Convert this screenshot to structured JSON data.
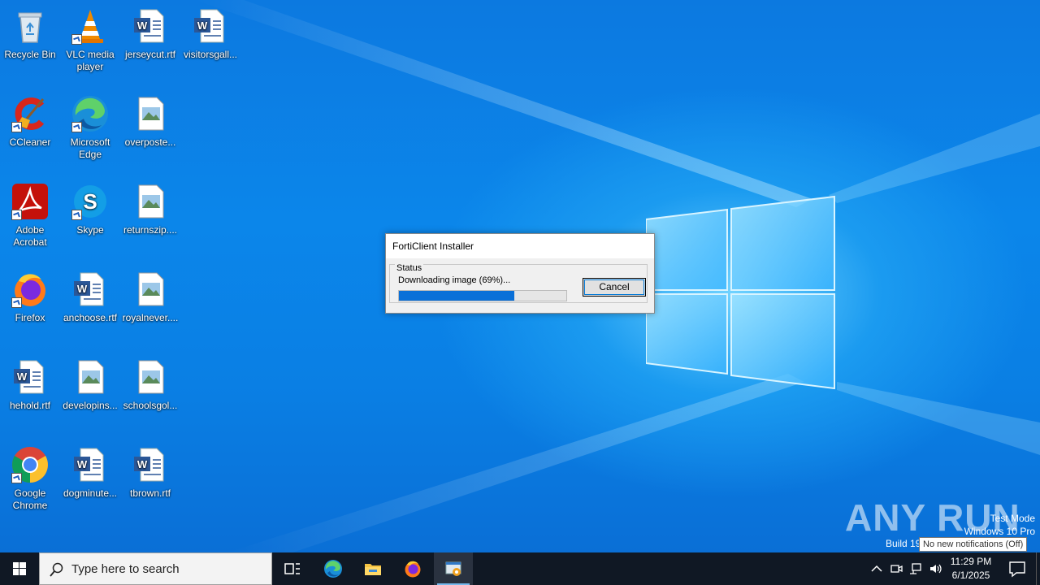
{
  "desktop_icons": [
    {
      "label": "Recycle Bin",
      "icon": "recycle-bin-icon"
    },
    {
      "label": "VLC media player",
      "icon": "vlc-icon"
    },
    {
      "label": "jerseycut.rtf",
      "icon": "word-doc-icon"
    },
    {
      "label": "visitorsgall...",
      "icon": "word-doc-icon"
    },
    {
      "label": "CCleaner",
      "icon": "ccleaner-icon"
    },
    {
      "label": "Microsoft Edge",
      "icon": "edge-icon"
    },
    {
      "label": "overposte...",
      "icon": "image-file-icon"
    },
    {
      "label": "Adobe Acrobat",
      "icon": "acrobat-icon"
    },
    {
      "label": "Skype",
      "icon": "skype-icon"
    },
    {
      "label": "returnszip....",
      "icon": "image-file-icon"
    },
    {
      "label": "Firefox",
      "icon": "firefox-icon"
    },
    {
      "label": "anchoose.rtf",
      "icon": "word-doc-icon"
    },
    {
      "label": "royalnever....",
      "icon": "image-file-icon"
    },
    {
      "label": "hehold.rtf",
      "icon": "word-doc-icon"
    },
    {
      "label": "developins...",
      "icon": "image-file-icon"
    },
    {
      "label": "schoolsgol...",
      "icon": "image-file-icon"
    },
    {
      "label": "Google Chrome",
      "icon": "chrome-icon"
    },
    {
      "label": "dogminute...",
      "icon": "word-doc-icon"
    },
    {
      "label": "tbrown.rtf",
      "icon": "word-doc-icon"
    }
  ],
  "dialog": {
    "title": "FortiClient Installer",
    "group_label": "Status",
    "status_text": "Downloading image (69%)...",
    "progress": 0.69,
    "cancel_label": "Cancel"
  },
  "watermark": {
    "brand": "ANY RUN",
    "test_mode": "Test Mode",
    "edition": "Windows 10 Pro",
    "build": "Build 19"
  },
  "tooltip": "No new notifications (Off)",
  "taskbar": {
    "search_placeholder": "Type here to search",
    "time": "11:29 PM",
    "date": "6/1/2025"
  },
  "colors": {
    "accent": "#0078d7",
    "progress_fill": "#0a70d8",
    "taskbar_bg": "#101824"
  }
}
